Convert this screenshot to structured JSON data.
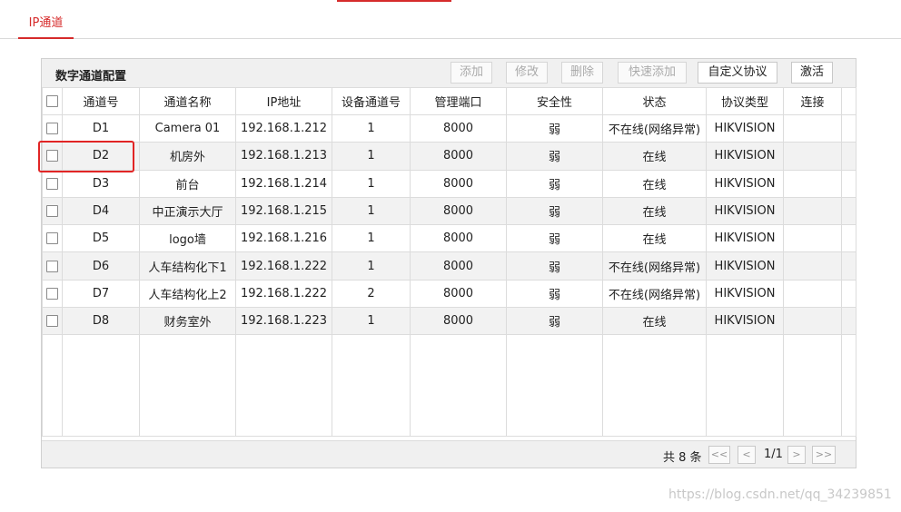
{
  "tab": {
    "label": "IP通道"
  },
  "panel": {
    "title": "数字通道配置"
  },
  "toolbar": {
    "add": "添加",
    "modify": "修改",
    "delete": "删除",
    "quick_add": "快速添加",
    "custom_protocol": "自定义协议",
    "activate": "激活"
  },
  "columns": [
    "通道号",
    "通道名称",
    "IP地址",
    "设备通道号",
    "管理端口",
    "安全性",
    "状态",
    "协议类型",
    "连接"
  ],
  "rows": [
    {
      "ch": "D1",
      "name": "Camera 01",
      "ip": "192.168.1.212",
      "dev_ch": "1",
      "port": "8000",
      "sec": "弱",
      "status": "不在线(网络异常)",
      "proto": "HIKVISION",
      "conn": ""
    },
    {
      "ch": "D2",
      "name": "机房外",
      "ip": "192.168.1.213",
      "dev_ch": "1",
      "port": "8000",
      "sec": "弱",
      "status": "在线",
      "proto": "HIKVISION",
      "conn": ""
    },
    {
      "ch": "D3",
      "name": "前台",
      "ip": "192.168.1.214",
      "dev_ch": "1",
      "port": "8000",
      "sec": "弱",
      "status": "在线",
      "proto": "HIKVISION",
      "conn": ""
    },
    {
      "ch": "D4",
      "name": "中正演示大厅",
      "ip": "192.168.1.215",
      "dev_ch": "1",
      "port": "8000",
      "sec": "弱",
      "status": "在线",
      "proto": "HIKVISION",
      "conn": ""
    },
    {
      "ch": "D5",
      "name": "logo墙",
      "ip": "192.168.1.216",
      "dev_ch": "1",
      "port": "8000",
      "sec": "弱",
      "status": "在线",
      "proto": "HIKVISION",
      "conn": ""
    },
    {
      "ch": "D6",
      "name": "人车结构化下1",
      "ip": "192.168.1.222",
      "dev_ch": "1",
      "port": "8000",
      "sec": "弱",
      "status": "不在线(网络异常)",
      "proto": "HIKVISION",
      "conn": ""
    },
    {
      "ch": "D7",
      "name": "人车结构化上2",
      "ip": "192.168.1.222",
      "dev_ch": "2",
      "port": "8000",
      "sec": "弱",
      "status": "不在线(网络异常)",
      "proto": "HIKVISION",
      "conn": ""
    },
    {
      "ch": "D8",
      "name": "财务室外",
      "ip": "192.168.1.223",
      "dev_ch": "1",
      "port": "8000",
      "sec": "弱",
      "status": "在线",
      "proto": "HIKVISION",
      "conn": ""
    }
  ],
  "pagination": {
    "total": "共 8 条",
    "first": "<<",
    "prev": "<",
    "page": "1/1",
    "next": ">",
    "last": ">>"
  },
  "highlighted_row": "D2",
  "watermark": "https://blog.csdn.net/qq_34239851",
  "colors": {
    "accent": "#d62b2b",
    "highlight_box": "#e12525",
    "header_bg": "#f0f0f0",
    "alt_row_bg": "#f2f2f2"
  },
  "icons": {
    "row_select": "checkbox-icon",
    "select_all": "checkbox-icon"
  }
}
